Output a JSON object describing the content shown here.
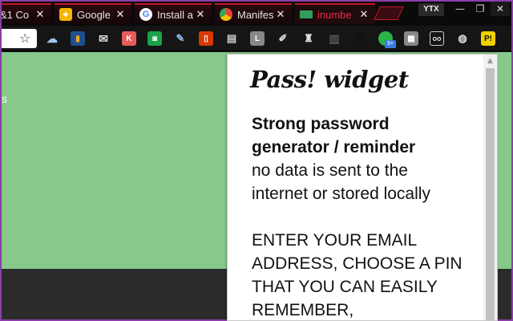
{
  "tabs": [
    {
      "title": "&1 Co",
      "favicon": "none"
    },
    {
      "title": "Google",
      "favicon": "lightbulb-icon",
      "color": "#f4b400"
    },
    {
      "title": "Install a",
      "favicon": "google-g-icon",
      "color": "#4285f4"
    },
    {
      "title": "Manifes",
      "favicon": "chrome-icon",
      "color": "#34a853"
    },
    {
      "title": "inumbe",
      "favicon": "page-icon",
      "color": "#2f9e5a"
    }
  ],
  "tab_close_glyph": "✕",
  "profile_label": "YTX",
  "window_controls": {
    "minimize": "—",
    "restore": "❐",
    "close": "✕"
  },
  "extensions_badge": "9+",
  "extension_icons": [
    "cloud-icon",
    "chart-icon",
    "mail-icon",
    "k-icon",
    "robot-icon",
    "pen-icon",
    "office-icon",
    "notes-icon",
    "l-icon",
    "brush-icon",
    "stamp-icon",
    "book-icon",
    "bear-icon",
    "green-circle-icon",
    "puzzle-icon",
    "owl-icon",
    "pin-icon",
    "pass-widget-icon"
  ],
  "page": {
    "left_fragment": "s",
    "colors": {
      "green": "#86c98b",
      "dark": "#2b2b2b"
    }
  },
  "popup": {
    "title": "Pass! widget",
    "heading_line1": "Strong password",
    "heading_line2": "generator / reminder",
    "desc_line1": "no data is sent to the",
    "desc_line2": "internet or stored locally",
    "caps_line1": "ENTER YOUR EMAIL",
    "caps_line2": "ADDRESS, CHOOSE A PIN",
    "caps_line3": "THAT YOU CAN EASILY",
    "caps_line4": "REMEMBER,"
  }
}
